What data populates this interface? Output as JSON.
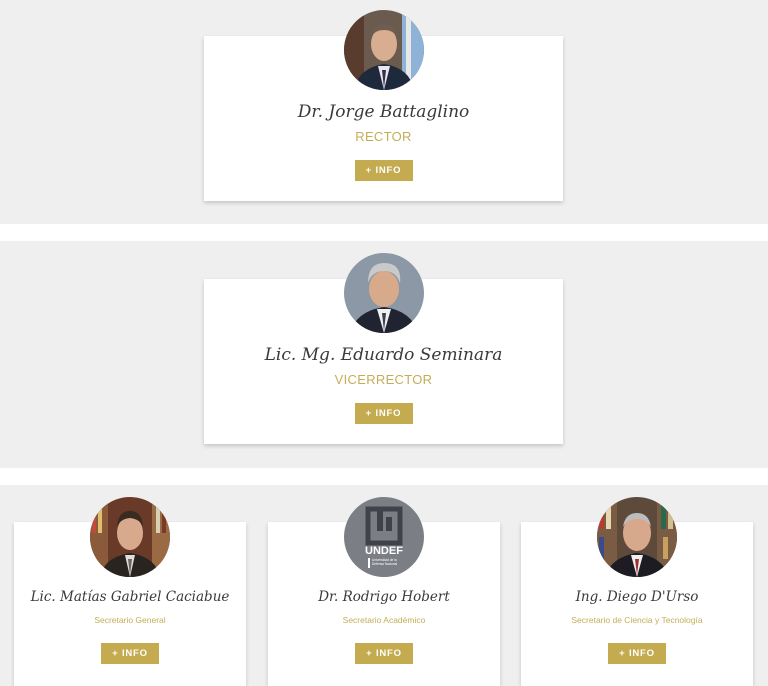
{
  "cards": [
    {
      "name": "Dr. Jorge Battaglino",
      "role": "RECTOR",
      "button": "+ INFO",
      "avatar": "portrait-photo"
    },
    {
      "name": "Lic. Mg. Eduardo Seminara",
      "role": "VICERRECTOR",
      "button": "+ INFO",
      "avatar": "portrait-photo"
    },
    {
      "name": "Lic. Matías Gabriel Caciabue",
      "role": "Secretario General",
      "button": "+ INFO",
      "avatar": "portrait-photo"
    },
    {
      "name": "Dr. Rodrigo Hobert",
      "role": "Secretario Académico",
      "button": "+ INFO",
      "avatar": "undef-logo",
      "logo": {
        "text": "UNDEF",
        "subtext": "Universidad de la Defensa Nacional"
      }
    },
    {
      "name": "Ing. Diego D'Urso",
      "role": "Secretario de Ciencia y Tecnología",
      "button": "+ INFO",
      "avatar": "portrait-photo"
    }
  ],
  "colors": {
    "accent": "#c4ab4f",
    "role_text": "#c5ad58",
    "band_bg": "#efefef"
  }
}
